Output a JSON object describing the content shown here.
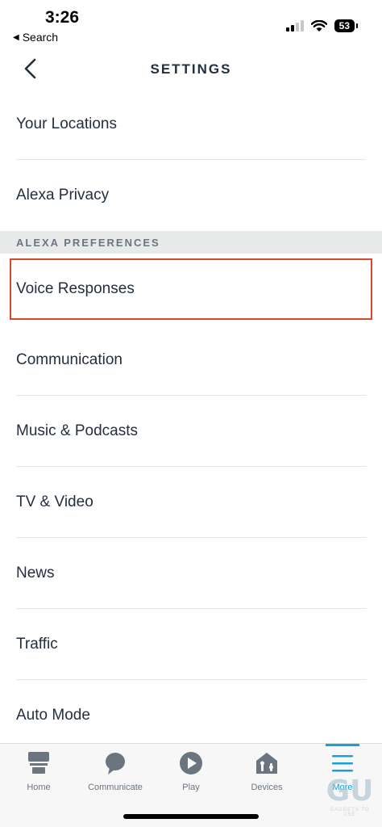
{
  "status_bar": {
    "time": "3:26",
    "back_app": "Search",
    "battery": "53"
  },
  "header": {
    "title": "SETTINGS",
    "back_icon": "chevron-left-icon"
  },
  "list": {
    "items_top": [
      {
        "label": "Your Locations"
      },
      {
        "label": "Alexa Privacy"
      }
    ],
    "section_title": "ALEXA PREFERENCES",
    "items": [
      {
        "label": "Voice Responses",
        "highlighted": true
      },
      {
        "label": "Communication"
      },
      {
        "label": "Music & Podcasts"
      },
      {
        "label": "TV & Video"
      },
      {
        "label": "News"
      },
      {
        "label": "Traffic"
      },
      {
        "label": "Auto Mode"
      }
    ]
  },
  "tab_bar": {
    "tabs": [
      {
        "label": "Home",
        "icon": "home-icon"
      },
      {
        "label": "Communicate",
        "icon": "chat-bubble-icon"
      },
      {
        "label": "Play",
        "icon": "play-icon"
      },
      {
        "label": "Devices",
        "icon": "devices-icon"
      },
      {
        "label": "More",
        "icon": "menu-icon",
        "active": true
      }
    ]
  },
  "watermark": {
    "logo": "GU",
    "text": "GADGETS TO USE"
  },
  "colors": {
    "text": "#232f3e",
    "accent": "#1aa0d8",
    "highlight_box": "#d9482b",
    "section_bg": "#e8e9e9",
    "tab_icon": "#6b7580"
  }
}
